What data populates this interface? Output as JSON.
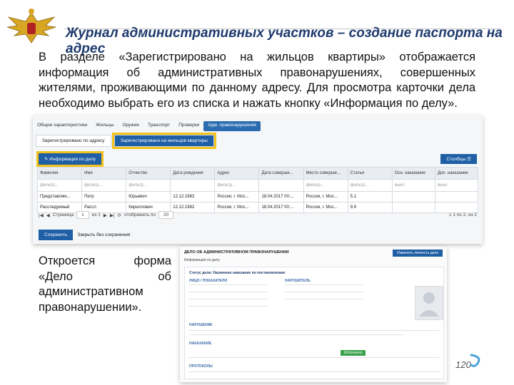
{
  "slide": {
    "title": "Журнал административных участков – создание паспорта на адрес",
    "paragraph": "В разделе «Зарегистрировано на жильцов квартиры» отображается информация об  административных правонарушениях, совершенных жителями, проживающими по данному адресу. Для просмотра карточки дела необходимо выбрать его из списка и нажать кнопку «Информация по делу».",
    "paragraph2": "Откроется форма «Дело об административном правонарушении».",
    "page_number": "120"
  },
  "shot1": {
    "top_tabs": [
      "Общие характеристики",
      "Жильцы",
      "Оружие",
      "Транспорт",
      "Проверки",
      "Адм. правонарушения"
    ],
    "sub_tabs": [
      "Зарегистрировано по адресу",
      "Зарегистрировано на жильцов квартиры"
    ],
    "info_button": "Информация по делу",
    "columns_button": "Столбцы",
    "columns": [
      "Фамилия",
      "Имя",
      "Отчество",
      "Дата рождения",
      "Адрес",
      "Дата соверше...",
      "Место соверше...",
      "Статья",
      "Осн. наказание",
      "Доп. наказание"
    ],
    "filter": [
      "фильтр...",
      "фильтр...",
      "фильтр...",
      "",
      "фильтр...",
      "",
      "фильтр...",
      "фильтр...",
      "выкл",
      "выкл"
    ],
    "filter_off": "выкл",
    "rows": [
      [
        "Представляю...",
        "Петр",
        "Юрьевич",
        "12.12.1982",
        "Россия, г. Мос...",
        "18.04.2017 00:...",
        "Россия, г. Мос...",
        "5.1",
        "",
        ""
      ],
      [
        "Расследуемый",
        "Рассл",
        "Кириллович",
        "12.12.1982",
        "Россия, г. Мос...",
        "18.04.2017 00:...",
        "Россия, г. Мос...",
        "9.9",
        "",
        ""
      ]
    ],
    "pager": {
      "page_label": "Страница",
      "page": "1",
      "of_label": "из 1",
      "show_label": "отображать по",
      "page_size": "20",
      "range": "с 1 по 2, из 2"
    },
    "save_button": "Сохранить",
    "close_button": "Закрыть без сохранения"
  },
  "shot2": {
    "header": "ДЕЛО ОБ АДМИНИСТРАТИВНОМ ПРАВОНАРУШЕНИИ",
    "header_button": "Изменить личность дела",
    "subtitle": "Информация по делу",
    "status": "Статус дела: Назначено наказание по постановлению",
    "left_section": "ЛИЦО / ПОКАЗАТЕЛИ",
    "right_section": "НАРУШИТЕЛЬ",
    "violation_section": "НАРУШЕНИЕ",
    "punishment_section": "НАКАЗАНИЕ",
    "protocols_section": "ПРОТОКОЛЫ",
    "green_label": "Исполнено"
  }
}
